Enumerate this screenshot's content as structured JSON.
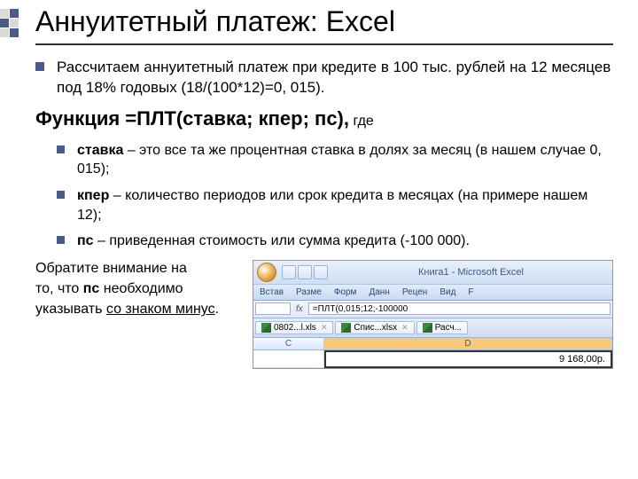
{
  "title": "Аннуитетный платеж: Excel",
  "intro": "Рассчитаем аннуитетный платеж при кредите в 100 тыс. рублей на 12 месяцев под 18% годовых (18/(100*12)=0, 015).",
  "func_heading_main": "Функция =ПЛТ(ставка; кпер; пс),",
  "func_heading_tail": " где",
  "params": [
    {
      "bold": "ставка",
      "rest": " – это все та же процентная ставка в долях за месяц (в нашем случае 0, 015);"
    },
    {
      "bold": "кпер",
      "rest": " – количество периодов или срок кредита в месяцах (на примере нашем 12);"
    },
    {
      "bold": "пс",
      "rest": " – приведенная стоимость или сумма кредита (-100 000)."
    }
  ],
  "note_l1": "Обратите внимание на",
  "note_l2": "то, что ",
  "note_bold": "пс",
  "note_l2b": " необходимо",
  "note_l3a": "указывать ",
  "note_underline": "со знаком минус",
  "note_l3b": ".",
  "excel": {
    "window_title": "Книга1 - Microsoft Excel",
    "tabs": [
      "Встав",
      "Разме",
      "Форм",
      "Данн",
      "Рецен",
      "Вид",
      "F"
    ],
    "fx": "fx",
    "formula": "=ПЛТ(0,015;12;-100000",
    "file_tabs": [
      "0802...l.xls",
      "Спис...xlsx",
      "Расч..."
    ],
    "cols": {
      "c": "C",
      "d": "D"
    },
    "result": "9 168,00р."
  }
}
